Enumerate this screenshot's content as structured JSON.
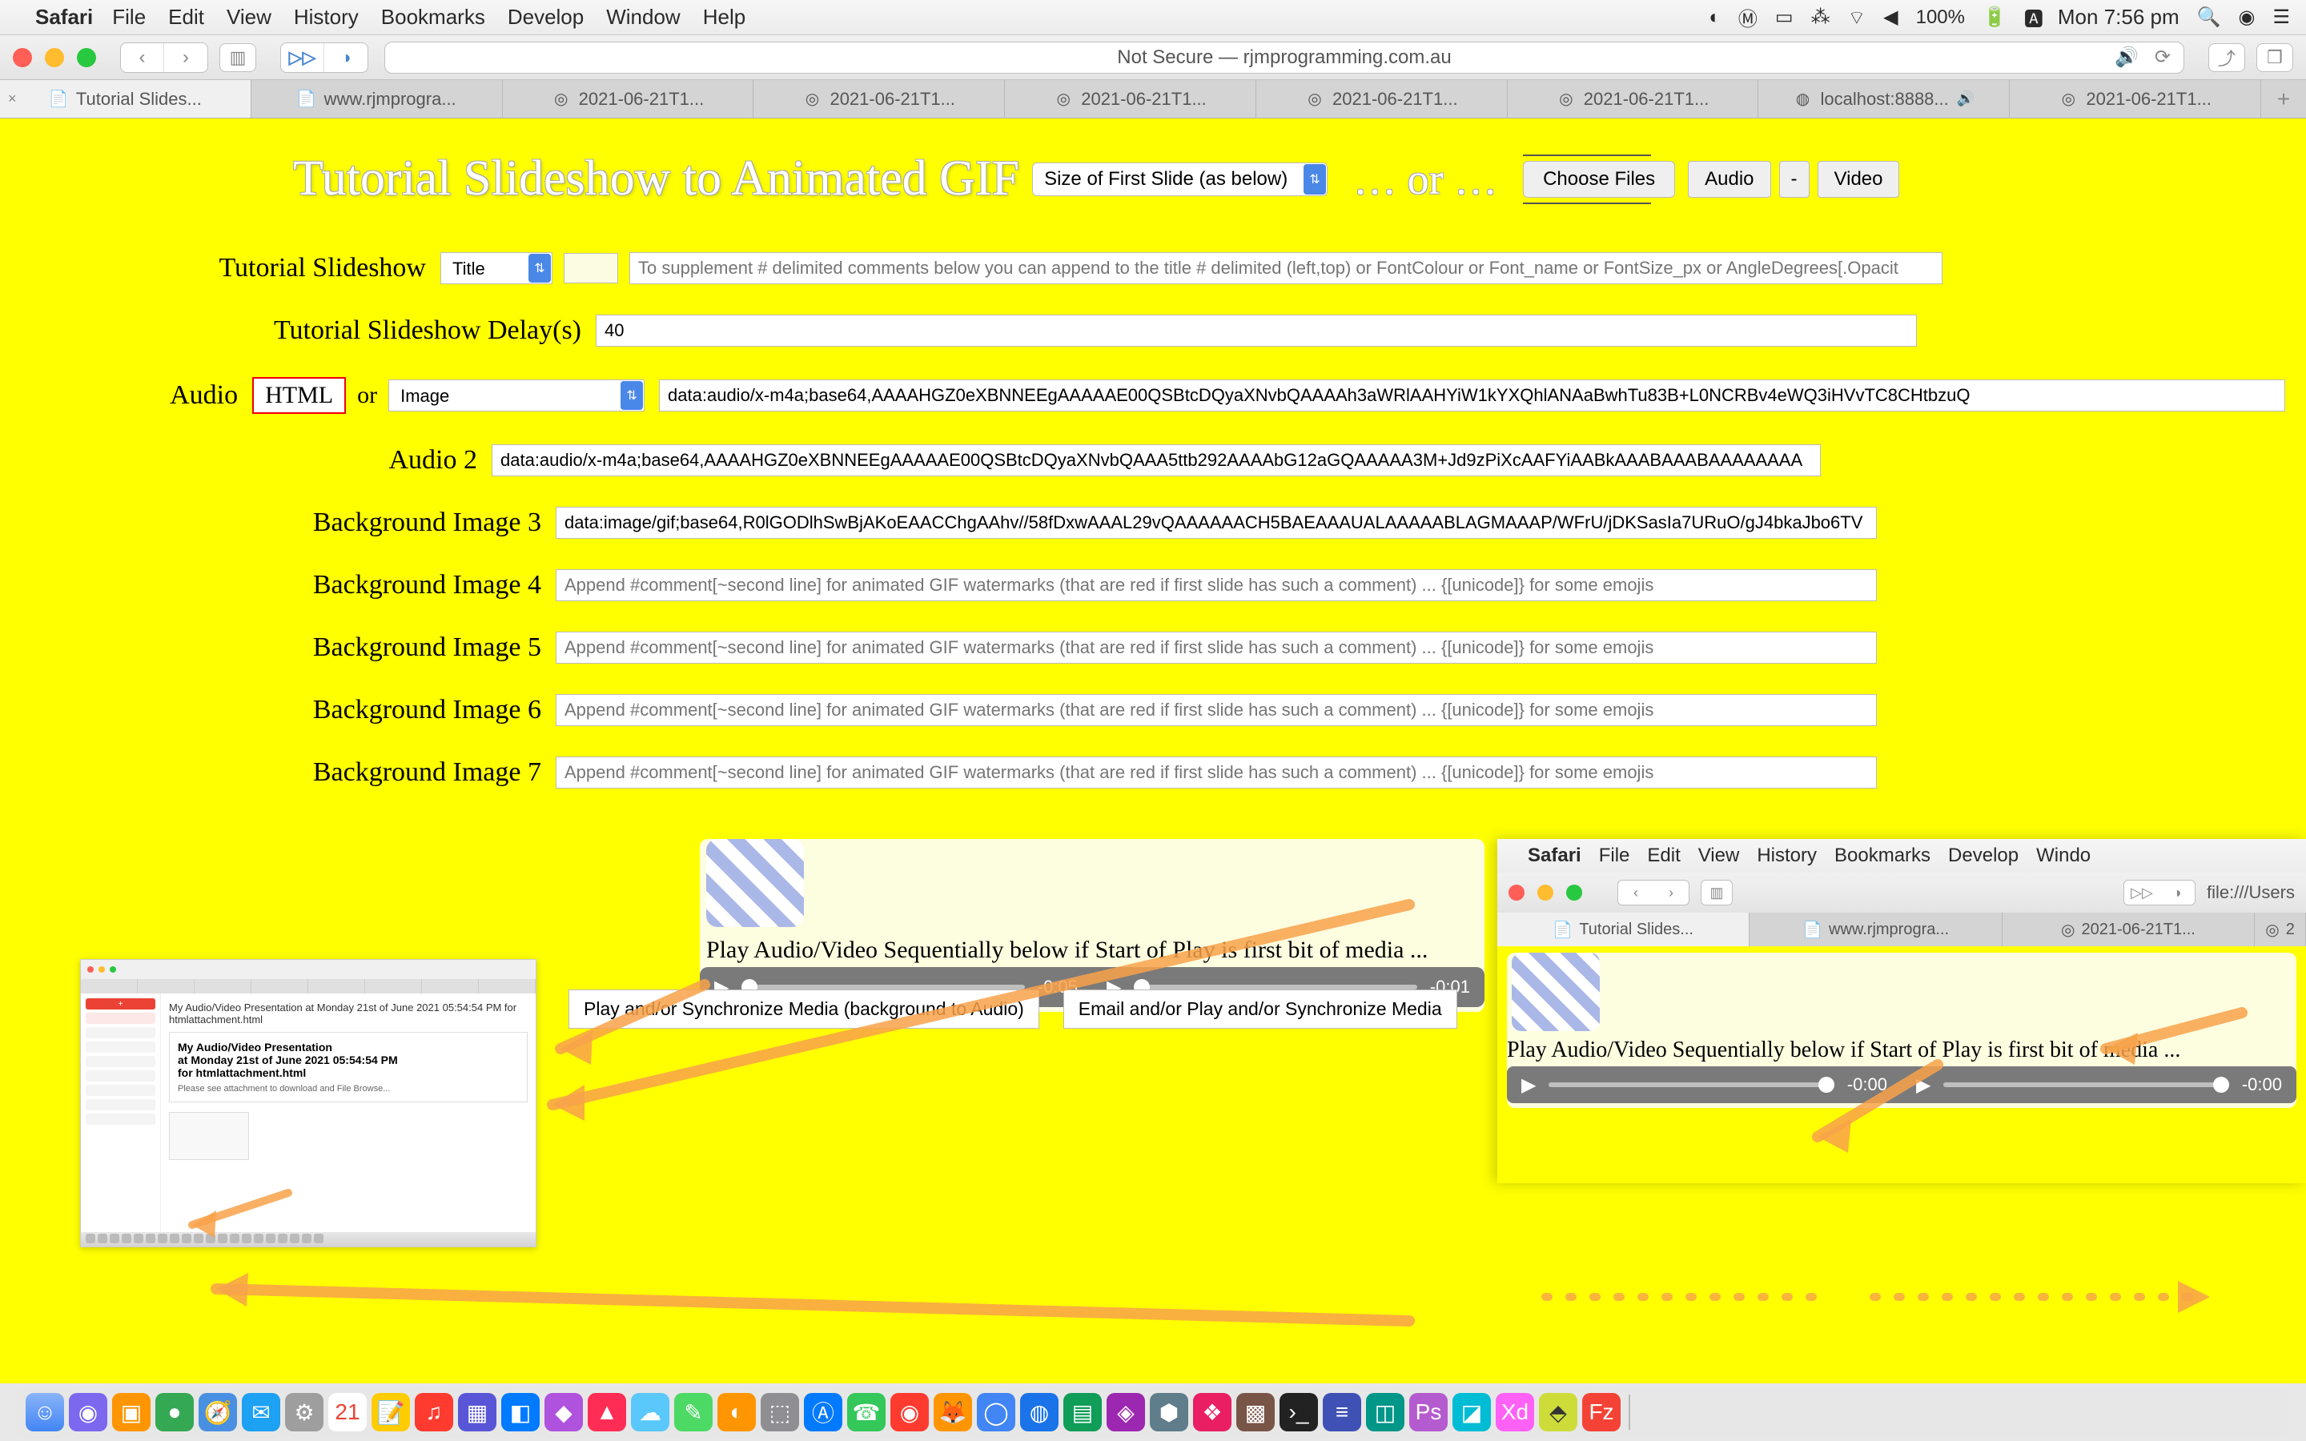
{
  "menubar": {
    "app": "Safari",
    "items": [
      "File",
      "Edit",
      "View",
      "History",
      "Bookmarks",
      "Develop",
      "Window",
      "Help"
    ],
    "right": {
      "battery": "100%",
      "battery_icon": "⚡",
      "clock": "Mon 7:56 pm"
    }
  },
  "toolbar": {
    "url": "Not Secure — rjmprogramming.com.au"
  },
  "tabs": [
    {
      "label": "Tutorial Slides...",
      "active": true,
      "icon": "📄"
    },
    {
      "label": "www.rjmprogra...",
      "icon": "📄"
    },
    {
      "label": "2021-06-21T1...",
      "icon": "◎"
    },
    {
      "label": "2021-06-21T1...",
      "icon": "◎"
    },
    {
      "label": "2021-06-21T1...",
      "icon": "◎"
    },
    {
      "label": "2021-06-21T1...",
      "icon": "◎"
    },
    {
      "label": "2021-06-21T1...",
      "icon": "◎"
    },
    {
      "label": "localhost:8888...",
      "icon": "◍",
      "sound": true
    },
    {
      "label": "2021-06-21T1...",
      "icon": "◎"
    }
  ],
  "page": {
    "title": "Tutorial Slideshow to Animated GIF",
    "size_select": "Size of First Slide (as below)",
    "or1": "… or …",
    "choose_files": "Choose Files",
    "audio_btn": "Audio",
    "video_btn": "Video",
    "minus": "-",
    "rows": {
      "r1_label": "Tutorial Slideshow",
      "r1_select": "Title",
      "r1_ph": "To supplement # delimited comments below you can append to the title # delimited (left,top) or FontColour or Font_name or FontSize_px or AngleDegrees[.Opacit",
      "r2_label": "Tutorial Slideshow Delay(s)",
      "r2_val": "40",
      "r3_label": "Audio",
      "r3_html": "HTML",
      "r3_or": "or",
      "r3_select": "Image",
      "r3_val": "data:audio/x-m4a;base64,AAAAHGZ0eXBNNEEgAAAAAE00QSBtcDQyaXNvbQAAAAh3aWRlAAHYiW1kYXQhlANAaBwhTu83B+L0NCRBv4eWQ3iHVvTC8CHtbzuQ",
      "r4_label": "Audio 2",
      "r4_val": "data:audio/x-m4a;base64,AAAAHGZ0eXBNNEEgAAAAAE00QSBtcDQyaXNvbQAAA5ttb292AAAAbG12aGQAAAAA3M+Jd9zPiXcAAFYiAABkAAABAAABAAAAAAAA",
      "bg3_label": "Background Image 3",
      "bg3_val": "data:image/gif;base64,R0lGODlhSwBjAKoEAACChgAAhv//58fDxwAAAL29vQAAAAAACH5BAEAAAUALAAAAABLAGMAAAP/WFrU/jDKSasIa7URuO/gJ4bkaJbo6TV",
      "bg4_label": "Background Image 4",
      "bg5_label": "Background Image 5",
      "bg6_label": "Background Image 6",
      "bg7_label": "Background Image 7",
      "bg_ph": "Append #comment[~second line] for animated GIF watermarks (that are red if first slide has such a comment) ... {[unicode]} for some emojis"
    },
    "player": {
      "title": "Play Audio/Video Sequentially below if Start of Play is first bit of media ...",
      "t1": "-0:05",
      "t2": "-0:01"
    },
    "sync1": "Play and/or Synchronize Media (background to Audio)",
    "sync2": "Email and/or Play and/or Synchronize Media"
  },
  "mini": {
    "subject": "My Audio/Video Presentation at Monday 21st of June 2021 05:54:54 PM for htmlattachment.html",
    "title": "My Audio/Video Presentation",
    "date": "at Monday 21st of June 2021 05:54:54 PM",
    "for": "for htmlattachment.html"
  },
  "nested": {
    "menubar": {
      "app": "Safari",
      "items": [
        "File",
        "Edit",
        "View",
        "History",
        "Bookmarks",
        "Develop",
        "Windo"
      ]
    },
    "url": "file:///Users",
    "tabs": [
      {
        "label": "Tutorial Slides...",
        "icon": "📄",
        "active": true
      },
      {
        "label": "www.rjmprogra...",
        "icon": "📄"
      },
      {
        "label": "2021-06-21T1...",
        "icon": "◎"
      },
      {
        "label": "2",
        "icon": "◎"
      }
    ],
    "ptitle": "Play Audio/Video Sequentially below if Start of Play is first bit of media ...",
    "t1": "-0:00",
    "t2": "-0:00"
  }
}
